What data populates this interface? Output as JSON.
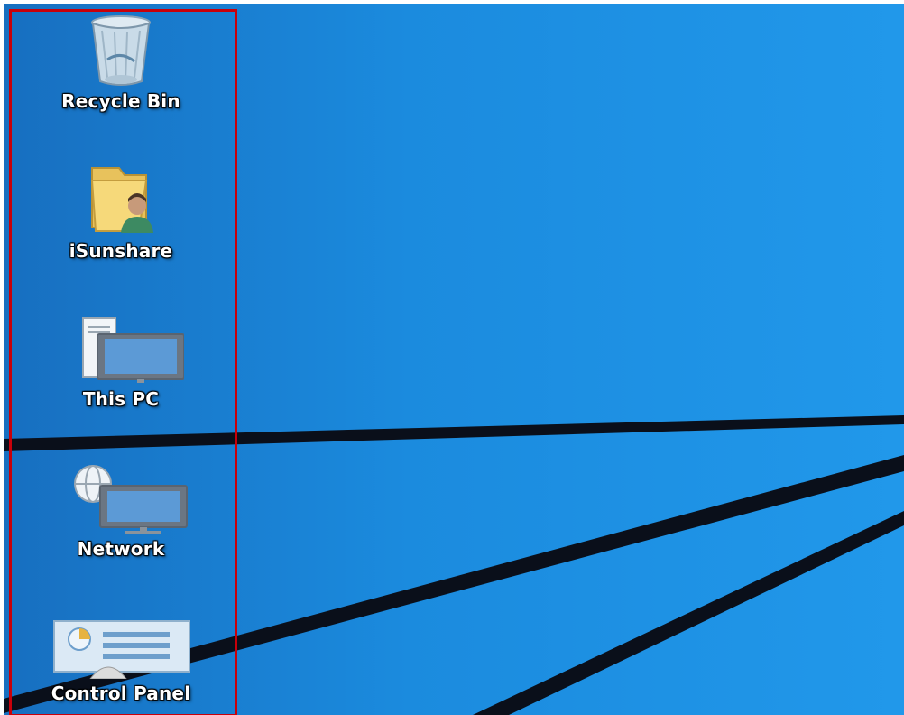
{
  "desktop": {
    "background_color": "#1a85d8",
    "selection_color": "#c8000a",
    "icons": [
      {
        "label": "Recycle Bin",
        "icon": "recycle-bin-icon"
      },
      {
        "label": "iSunshare",
        "icon": "user-folder-icon"
      },
      {
        "label": "This PC",
        "icon": "computer-icon"
      },
      {
        "label": "Network",
        "icon": "network-icon"
      },
      {
        "label": "Control Panel",
        "icon": "control-panel-icon"
      }
    ]
  }
}
